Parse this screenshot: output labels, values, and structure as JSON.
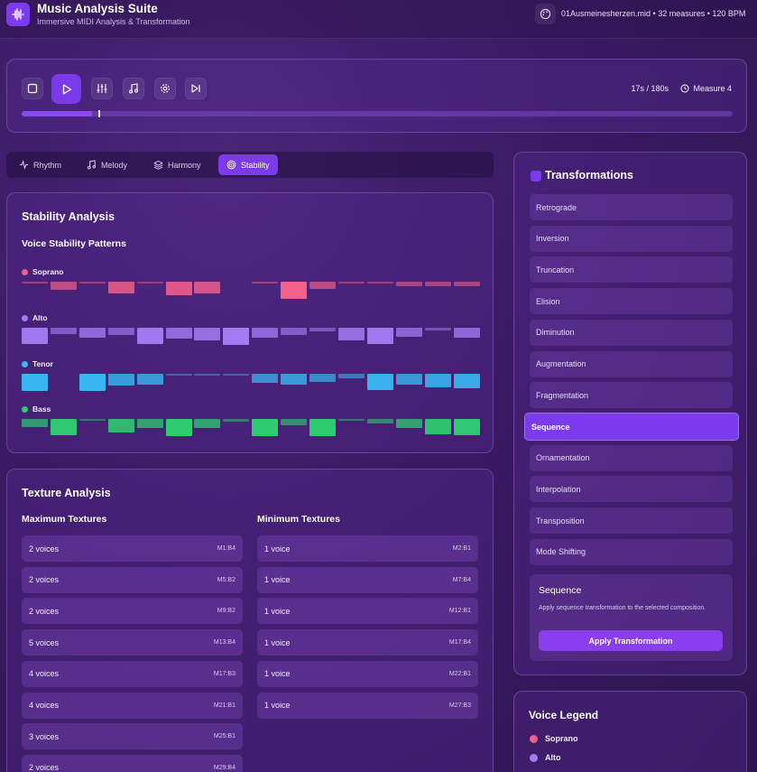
{
  "header": {
    "title": "Music Analysis Suite",
    "subtitle": "Immersive MIDI Analysis & Transformation",
    "file_info": "01Ausmeinesherzen.mid • 32 measures • 120 BPM",
    "icons": [
      "waveform-icon",
      "palette-icon"
    ]
  },
  "player": {
    "buttons": [
      "stop-icon",
      "play-icon",
      "sliders-icon",
      "music-note-icon",
      "gear-icon",
      "skip-forward-icon"
    ],
    "time": "17s / 180s",
    "measure": "Measure 4",
    "progress": 0.099
  },
  "tabs": [
    {
      "label": "Rhythm",
      "icon": "activity-icon",
      "active": false
    },
    {
      "label": "Melody",
      "icon": "music-note-icon",
      "active": false
    },
    {
      "label": "Harmony",
      "icon": "layers-icon",
      "active": false
    },
    {
      "label": "Stability",
      "icon": "target-icon",
      "active": true
    }
  ],
  "stability": {
    "title": "Stability Analysis",
    "subtitle": "Voice Stability Patterns",
    "voices": [
      {
        "name": "Soprano",
        "color": "#f0608a",
        "levels": [
          0.12,
          0.45,
          0.12,
          0.7,
          0.05,
          0.8,
          0.7,
          0,
          0.12,
          1.0,
          0.4,
          0.12,
          0.12,
          0.25,
          0.25,
          0.25
        ]
      },
      {
        "name": "Alto",
        "color": "#a37bf2",
        "levels": [
          0.95,
          0.35,
          0.6,
          0.4,
          0.95,
          0.65,
          0.75,
          1.0,
          0.6,
          0.4,
          0.2,
          0.75,
          0.95,
          0.55,
          0.15,
          0.6
        ]
      },
      {
        "name": "Tenor",
        "color": "#38b6f0",
        "levels": [
          1.0,
          0,
          1.0,
          0.7,
          0.65,
          0.05,
          0.05,
          0.05,
          0.55,
          0.65,
          0.45,
          0.25,
          0.95,
          0.65,
          0.8,
          0.85
        ]
      },
      {
        "name": "Bass",
        "color": "#2ecc71",
        "levels": [
          0.45,
          0.95,
          0.05,
          0.8,
          0.55,
          1.0,
          0.55,
          0.15,
          1.0,
          0.35,
          1.0,
          0.1,
          0.25,
          0.55,
          0.9,
          0.95
        ]
      }
    ]
  },
  "texture": {
    "title": "Texture Analysis",
    "max_title": "Maximum Textures",
    "min_title": "Minimum Textures",
    "max": [
      {
        "voices": "2 voices",
        "pos": "M1:B4"
      },
      {
        "voices": "2 voices",
        "pos": "M5:B2"
      },
      {
        "voices": "2 voices",
        "pos": "M9:B2"
      },
      {
        "voices": "5 voices",
        "pos": "M13:B4"
      },
      {
        "voices": "4 voices",
        "pos": "M17:B3"
      },
      {
        "voices": "4 voices",
        "pos": "M21:B1"
      },
      {
        "voices": "3 voices",
        "pos": "M25:B1"
      },
      {
        "voices": "2 voices",
        "pos": "M29:B4"
      }
    ],
    "min": [
      {
        "voices": "1 voice",
        "pos": "M2:B1"
      },
      {
        "voices": "1 voice",
        "pos": "M7:B4"
      },
      {
        "voices": "1 voice",
        "pos": "M12:B1"
      },
      {
        "voices": "1 voice",
        "pos": "M17:B4"
      },
      {
        "voices": "1 voice",
        "pos": "M22:B1"
      },
      {
        "voices": "1 voice",
        "pos": "M27:B3"
      }
    ]
  },
  "transformations": {
    "title": "Transformations",
    "items": [
      "Retrograde",
      "Inversion",
      "Truncation",
      "Elision",
      "Diminution",
      "Augmentation",
      "Fragmentation",
      "Sequence",
      "Ornamentation",
      "Interpolation",
      "Transposition",
      "Mode Shifting"
    ],
    "active": "Sequence",
    "detail_title": "Sequence",
    "detail_desc": "Apply sequence transformation to the selected composition.",
    "apply_label": "Apply Transformation"
  },
  "legend": {
    "title": "Voice Legend",
    "items": [
      {
        "name": "Soprano",
        "color": "#f0608a"
      },
      {
        "name": "Alto",
        "color": "#a37bf2"
      }
    ]
  }
}
